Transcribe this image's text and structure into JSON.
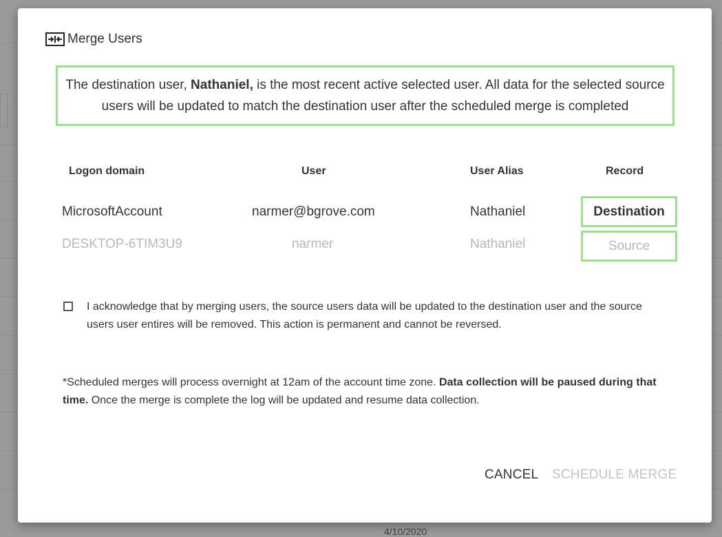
{
  "dialog": {
    "title": "Merge Users",
    "title_icon": "merge-arrows-icon",
    "notice": {
      "part1": "The destination user, ",
      "user_name": "Nathaniel,",
      "part2": " is the most recent active selected user. All data for the selected source users will be updated to match the destination user after the scheduled merge is completed"
    },
    "table": {
      "headers": {
        "logon_domain": "Logon domain",
        "user": "User",
        "user_alias": "User Alias",
        "record": "Record"
      },
      "rows": [
        {
          "logon_domain": "MicrosoftAccount",
          "user": "narmer@bgrove.com",
          "user_alias": "Nathaniel",
          "record": "Destination"
        },
        {
          "logon_domain": "DESKTOP-6TIM3U9",
          "user": "narmer",
          "user_alias": "Nathaniel",
          "record": "Source"
        }
      ]
    },
    "acknowledge": {
      "checked": false,
      "text": "I acknowledge that by merging users, the source users data will be updated to the destination user and the source users user entires will be removed.  This action is permanent and cannot be reversed."
    },
    "footnote": {
      "part1": "*Scheduled merges will process overnight at 12am of the account time zone. ",
      "bold": "Data collection will be paused during that time.",
      "part2": " Once the merge is complete the log will be updated and resume data collection."
    },
    "buttons": {
      "cancel": "CANCEL",
      "schedule_merge": "SCHEDULE MERGE"
    }
  },
  "background": {
    "peek_text": "4/10/2020"
  },
  "colors": {
    "accent_border": "#9be08a",
    "overlay": "#9a9a9a",
    "disabled_text": "#c4c4c4"
  }
}
